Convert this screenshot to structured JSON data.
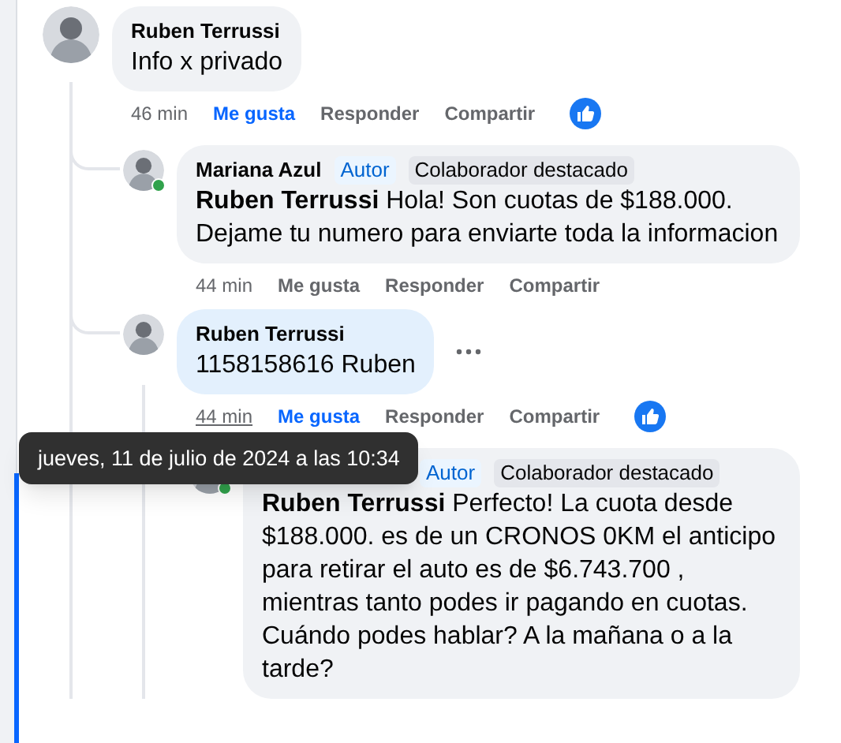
{
  "comments": [
    {
      "author": "Ruben Terrussi",
      "text": "Info x privado",
      "time": "46 min",
      "actions": [
        "Me gusta",
        "Responder",
        "Compartir"
      ],
      "liked": true,
      "reaction": true,
      "online": false,
      "highlighted": false,
      "hovered": false,
      "children": [
        {
          "author": "Mariana Azul",
          "badges": [
            {
              "label": "Autor",
              "kind": "author"
            },
            {
              "label": "Colaborador destacado",
              "kind": "fan"
            }
          ],
          "text": "**Ruben Terrussi** Hola! Son cuotas de $188.000. Dejame tu numero para enviarte toda la informacion",
          "time": "44 min",
          "actions": [
            "Me gusta",
            "Responder",
            "Compartir"
          ],
          "liked": false,
          "reaction": false,
          "online": true,
          "highlighted": false,
          "hovered": false
        },
        {
          "author": "Ruben Terrussi",
          "text": "1158158616 Ruben",
          "time": "44 min",
          "actions": [
            "Me gusta",
            "Responder",
            "Compartir"
          ],
          "liked": true,
          "reaction": true,
          "online": false,
          "highlighted": true,
          "hovered": true,
          "children": [
            {
              "badges": [
                {
                  "label": "Autor",
                  "kind": "author"
                },
                {
                  "label": "Colaborador destacado",
                  "kind": "fan"
                }
              ],
              "text": "**Ruben Terrussi** Perfecto! La cuota desde $188.000. es de un CRONOS 0KM el anticipo para retirar el auto es de $6.743.700 , mientras tanto podes ir pagando en cuotas. Cuándo podes hablar? A la mañana o a la tarde?",
              "online": true,
              "highlighted": false,
              "hovered": false
            }
          ]
        }
      ]
    }
  ],
  "tooltip": "jueves, 11 de julio de 2024 a las 10:34"
}
